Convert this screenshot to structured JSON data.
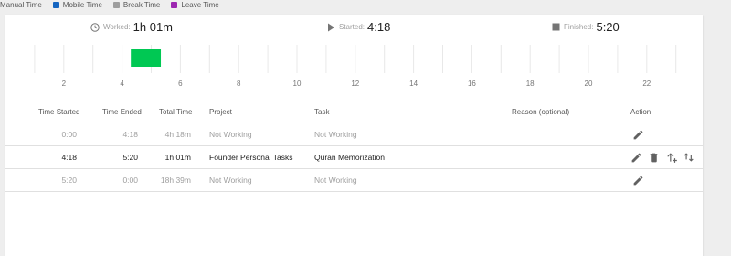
{
  "legend": [
    {
      "label": "Manual Time",
      "color": "#ffffff"
    },
    {
      "label": "Mobile Time",
      "color": "#1565c0"
    },
    {
      "label": "Break Time",
      "color": "#9e9e9e"
    },
    {
      "label": "Leave Time",
      "color": "#9c27b0"
    }
  ],
  "summary": {
    "worked_label": "Worked:",
    "worked_value": "1h 01m",
    "started_label": "Started:",
    "started_value": "4:18",
    "finished_label": "Finished:",
    "finished_value": "5:20"
  },
  "timeline": {
    "hour_min": 0,
    "hour_max": 24,
    "tick_labels": [
      "2",
      "4",
      "6",
      "8",
      "10",
      "12",
      "14",
      "16",
      "18",
      "20",
      "22"
    ],
    "segment": {
      "start_hour": 4.3,
      "end_hour": 5.33,
      "color": "#00c853"
    }
  },
  "table": {
    "headers": {
      "time_started": "Time Started",
      "time_ended": "Time Ended",
      "total_time": "Total Time",
      "project": "Project",
      "task": "Task",
      "reason": "Reason (optional)",
      "action": "Action"
    },
    "rows": [
      {
        "start": "0:00",
        "end": "4:18",
        "total": "4h 18m",
        "project": "Not Working",
        "task": "Not Working",
        "reason": ""
      },
      {
        "start": "4:18",
        "end": "5:20",
        "total": "1h 01m",
        "project": "Founder Personal Tasks",
        "task": "Quran Memorization",
        "reason": ""
      },
      {
        "start": "5:20",
        "end": "0:00",
        "total": "18h 39m",
        "project": "Not Working",
        "task": "Not Working",
        "reason": ""
      }
    ]
  },
  "icons": {
    "worked": "clock-icon",
    "started": "play-icon",
    "finished": "stop-icon",
    "edit": "pencil-icon",
    "delete": "trash-icon",
    "split_up": "arrow-up-plus-icon",
    "split_down": "swap-vertical-icon"
  }
}
